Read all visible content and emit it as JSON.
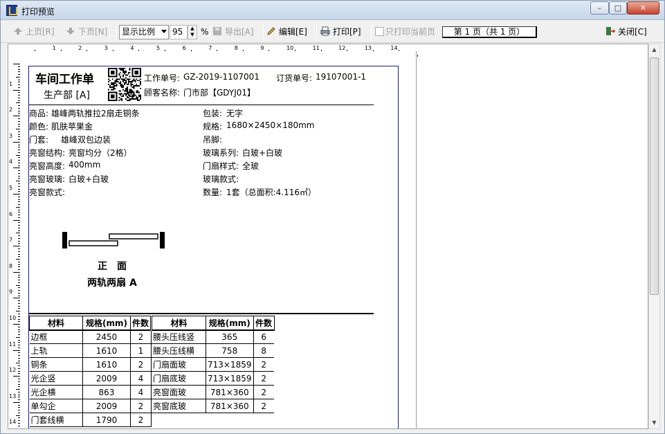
{
  "window": {
    "title": "打印预览",
    "min": "–",
    "max": "□",
    "close": "✕"
  },
  "toolbar": {
    "prev": "上页[R]",
    "next": "下页[N]",
    "zoom_mode": "显示比例",
    "zoom_value": "95",
    "zoom_unit": "%",
    "export": "导出[A]",
    "edit": "编辑[E]",
    "print": "打印[P]",
    "only_current": "只打印当前页",
    "page_indicator": "第 1 页（共 1 页）",
    "close": "关闭[C]"
  },
  "ruler": {
    "top": [
      "1",
      "2",
      "3",
      "4",
      "5",
      "6",
      "7",
      "8",
      "9",
      "10",
      "11",
      "12",
      "13",
      "14"
    ],
    "left": [
      "1",
      "2",
      "3",
      "4",
      "5",
      "6",
      "7",
      "8",
      "9",
      "10",
      "11",
      "12",
      "13",
      "14"
    ]
  },
  "report": {
    "title": "车间工作单",
    "dept": "生产部 [A]",
    "order_label": "工作单号:",
    "order_no": "GZ-2019-1107001",
    "po_label": "订货单号:",
    "po_no": "19107001-1",
    "customer_label": "顾客名称:",
    "customer": "门市部【GDYJ01】",
    "left_fields": [
      {
        "label": "商品:",
        "value": "雄峰两轨推拉2扇走铜条"
      },
      {
        "label": "颜色:",
        "value": "肌肤苹果金"
      },
      {
        "label": "门套:",
        "value": "雄峰双包边装"
      },
      {
        "label": "亮窗结构:",
        "value": "亮窗均分（2格）"
      },
      {
        "label": "亮窗高度:",
        "value": "400mm"
      },
      {
        "label": "亮窗玻璃:",
        "value": "白玻+白玻"
      },
      {
        "label": "亮窗款式:",
        "value": ""
      }
    ],
    "right_fields": [
      {
        "label": "包装:",
        "value": "无字"
      },
      {
        "label": "规格:",
        "value": "1680×2450×180mm"
      },
      {
        "label": "吊脚:",
        "value": ""
      },
      {
        "label": "玻璃系列:",
        "value": "白玻+白玻"
      },
      {
        "label": "门扇样式:",
        "value": "全玻"
      },
      {
        "label": "玻璃款式:",
        "value": ""
      },
      {
        "label": "数量:",
        "value": "1套（总面积:4.116㎡）"
      }
    ],
    "diagram_caption1": "正　面",
    "diagram_caption2": "两轨两扇 A",
    "table_headers": [
      "材料",
      "规格(mm)",
      "件数",
      "材料",
      "规格(mm)",
      "件数"
    ],
    "rows": [
      [
        "边框",
        "2450",
        "2",
        "腰头压线竖",
        "365",
        "6"
      ],
      [
        "上轨",
        "1610",
        "1",
        "腰头压线横",
        "758",
        "8"
      ],
      [
        "铜条",
        "1610",
        "2",
        "门扇面玻",
        "713×1859",
        "2"
      ],
      [
        "光企竖",
        "2009",
        "4",
        "门扇底玻",
        "713×1859",
        "2"
      ],
      [
        "光企横",
        "863",
        "4",
        "亮窗面玻",
        "781×360",
        "2"
      ],
      [
        "单勾企",
        "2009",
        "2",
        "亮窗底玻",
        "781×360",
        "2"
      ],
      [
        "门套线横",
        "1790",
        "2",
        "",
        "",
        ""
      ]
    ]
  }
}
